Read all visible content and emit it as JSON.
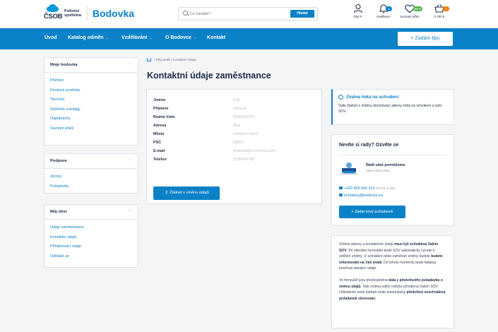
{
  "brand": {
    "bank_name": "ČSOB",
    "sub_line1": "Poštovní",
    "sub_line2": "spořitelna",
    "app_name": "Bodovka"
  },
  "search": {
    "placeholder": "Co hledáte?",
    "button_label": "Hledat"
  },
  "header_icons": [
    {
      "name": "user-icon",
      "label": "Filip F."
    },
    {
      "name": "bell-icon",
      "label": "Notifikace",
      "badge": "4"
    },
    {
      "name": "heart-icon",
      "label": "Seznam přání",
      "badge": "59 %"
    },
    {
      "name": "cart-icon",
      "label": "2 780 b",
      "badge": "1"
    }
  ],
  "colors": {
    "primary": "#0b82c7",
    "notif_badge": "#0b82c7",
    "wish_badge": "#52b848",
    "cart_badge": "#f07d00"
  },
  "nav": {
    "items": [
      {
        "label": "Úvod",
        "dropdown": false
      },
      {
        "label": "Katalog odměn",
        "dropdown": true
      },
      {
        "label": "Vzdělávání",
        "dropdown": true
      },
      {
        "label": "O Bodovce",
        "dropdown": true
      },
      {
        "label": "Kontakt",
        "dropdown": false
      }
    ],
    "chevron": "⌄",
    "tip_button": "+ Zadání tipu"
  },
  "sidebar": {
    "sections": [
      {
        "title": "Moje bodovka",
        "items": [
          "Přehled",
          "Prodané produkty",
          "Tipování",
          "Žebříček extraligy",
          "Objednávky",
          "Seznam přání"
        ]
      },
      {
        "title": "Podpora",
        "items": [
          "Zprávy",
          "Požadavky"
        ]
      },
      {
        "title": "Můj účet",
        "items": [
          "Údaje zaměstnance",
          "Kontaktní údaje",
          "Přihlašovací údaje",
          "Odhlásit se"
        ]
      }
    ],
    "caret": "⌃"
  },
  "breadcrumb": {
    "level1": "Můj profil",
    "separator": "/",
    "level2": "Kontaktní údaje"
  },
  "page_title": "Kontaktní údaje zaměstnance",
  "contact": {
    "rows": [
      {
        "label": "Jméno",
        "value": "Filip"
      },
      {
        "label": "Příjmení",
        "value": "Testovic"
      },
      {
        "label": "Rodné číslo",
        "value": "8006082375"
      },
      {
        "label": "Adresa",
        "value": "Mos"
      },
      {
        "label": "Město",
        "value": "Hamřitice Bout"
      },
      {
        "label": "PSČ",
        "value": "58001"
      },
      {
        "label": "E-mail",
        "value": "jbndouti@hormbova.com"
      },
      {
        "label": "Telefon",
        "value": "1235456789"
      }
    ],
    "request_button": "Žádost o změnu údajů"
  },
  "pending_notice": {
    "title": "Změna čeká na schválení",
    "text": "Vaše žádost o změnu doručovací adresy čeká na schválení u vaší SOV."
  },
  "help_box": {
    "title": "Nevíte si rady? Ozvěte se",
    "heading": "Rádi vám pomůžeme",
    "subheading": "Zákaznická linka",
    "phone": "+420 469 660 912",
    "hours": "(Po-Pá, 8-16h)",
    "email": "kontaktuj@bodovka.eu",
    "cta": "+ Zadat nový požadavek"
  },
  "explanation": {
    "p1_a": "Změna adresy a kontaktních údajů ",
    "p1_b": "musí být schválena Vaším SOV",
    "p1_c": ". Po odeslání formuláře bude SOV automaticky vyzván k ověření změny. O schválení nebo zamítnutí změny budete ",
    "p1_d": "budete informováni na Váš email",
    "p1_e": ". Do tohoto momentu bude katalog používat stávající údaje.",
    "p2_a": "Ve formuláři jsou předvyplněna ",
    "p2_b": "data z předchozího požadavku o změnu údajů",
    "p2_c": ". Tato změna zatím nebyla schválena Vaším SOV. Odesláním nové žádosti bude automaticky ",
    "p2_d": "předchozí neschválený požadavek stornován",
    "p2_e": "."
  }
}
